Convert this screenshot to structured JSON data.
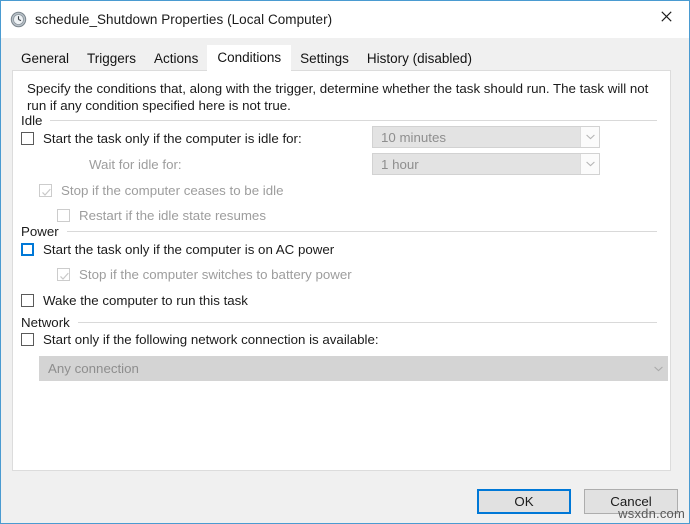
{
  "window": {
    "title": "schedule_Shutdown Properties (Local Computer)",
    "icon": "clock-task-icon",
    "close_label": "✕",
    "accent_color": "#0078d7",
    "border_color": "#4a9bd1"
  },
  "tabs": [
    {
      "label": "General",
      "active": false
    },
    {
      "label": "Triggers",
      "active": false
    },
    {
      "label": "Actions",
      "active": false
    },
    {
      "label": "Conditions",
      "active": true
    },
    {
      "label": "Settings",
      "active": false
    },
    {
      "label": "History (disabled)",
      "active": false
    }
  ],
  "content": {
    "description": "Specify the conditions that, along with the trigger, determine whether the task should run.  The task will not run  if any condition specified here is not true.",
    "groups": {
      "idle": {
        "label": "Idle",
        "start_if_idle": {
          "label": "Start the task only if the computer is idle for:",
          "checked": false,
          "enabled": true
        },
        "idle_duration": {
          "value": "10 minutes",
          "enabled": false
        },
        "wait_for_idle_label": "Wait for idle for:",
        "wait_for_idle": {
          "value": "1 hour",
          "enabled": false
        },
        "stop_if_ceases_idle": {
          "label": "Stop if the computer ceases to be idle",
          "checked": true,
          "enabled": false
        },
        "restart_if_idle_resumes": {
          "label": "Restart if the idle state resumes",
          "checked": false,
          "enabled": false
        }
      },
      "power": {
        "label": "Power",
        "start_if_ac_power": {
          "label": "Start the task only if the computer is on AC power",
          "checked": false,
          "enabled": true,
          "focused": true
        },
        "stop_if_battery": {
          "label": "Stop if the computer switches to battery power",
          "checked": true,
          "enabled": false
        },
        "wake_computer": {
          "label": "Wake the computer to run this task",
          "checked": false,
          "enabled": true
        }
      },
      "network": {
        "label": "Network",
        "start_if_network": {
          "label": "Start only if the following network connection is available:",
          "checked": false,
          "enabled": true
        },
        "connection": {
          "value": "Any connection",
          "enabled": false
        }
      }
    }
  },
  "buttons": {
    "ok": "OK",
    "cancel": "Cancel"
  },
  "watermark": "wsxdn.com"
}
